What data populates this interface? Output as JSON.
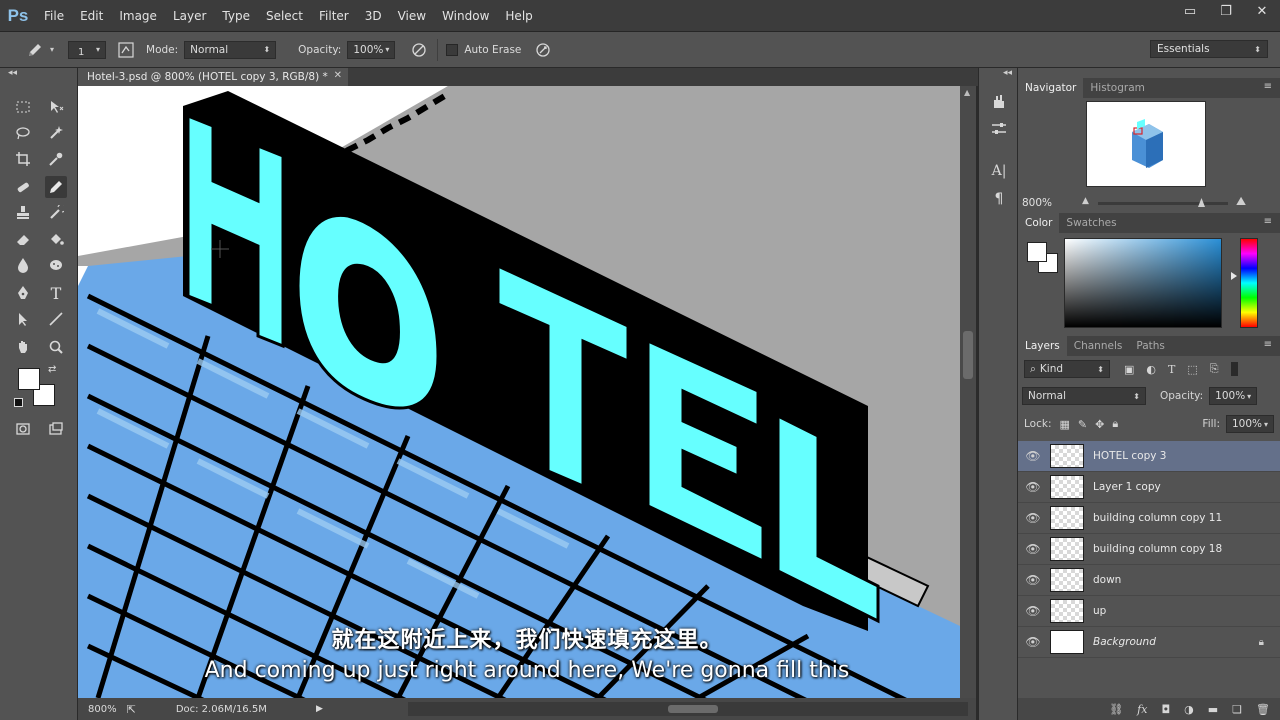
{
  "app": {
    "logo": "Ps"
  },
  "menu": [
    "File",
    "Edit",
    "Image",
    "Layer",
    "Type",
    "Select",
    "Filter",
    "3D",
    "View",
    "Window",
    "Help"
  ],
  "window_controls": {
    "minimize": "▭",
    "restore": "❐",
    "close": "✕"
  },
  "options_bar": {
    "brush_size": "1",
    "mode_label": "Mode:",
    "mode_value": "Normal",
    "opacity_label": "Opacity:",
    "opacity_value": "100%",
    "auto_erase_label": "Auto Erase",
    "workspace": "Essentials"
  },
  "document": {
    "tab_title": "Hotel-3.psd @ 800% (HOTEL copy 3, RGB/8) *",
    "status_zoom": "800%",
    "status_doc": "Doc: 2.06M/16.5M"
  },
  "subtitle": {
    "chinese": "就在这附近上来，我们快速填充这里。",
    "english": "And coming up just right around here, We're gonna fill this"
  },
  "navigator": {
    "tabs": [
      "Navigator",
      "Histogram"
    ],
    "zoom": "800%"
  },
  "color_panel": {
    "tabs": [
      "Color",
      "Swatches"
    ]
  },
  "layers_panel": {
    "tabs": [
      "Layers",
      "Channels",
      "Paths"
    ],
    "filter_kind": "Kind",
    "blend_mode": "Normal",
    "opacity_label": "Opacity:",
    "opacity_value": "100%",
    "lock_label": "Lock:",
    "fill_label": "Fill:",
    "fill_value": "100%",
    "layers": [
      {
        "name": "HOTEL copy 3",
        "selected": true
      },
      {
        "name": "Layer 1 copy",
        "selected": false
      },
      {
        "name": "building column copy 11",
        "selected": false
      },
      {
        "name": "building column copy 18",
        "selected": false
      },
      {
        "name": "down",
        "selected": false
      },
      {
        "name": "up",
        "selected": false
      },
      {
        "name": "Background",
        "selected": false
      }
    ]
  },
  "colors": {
    "sign_face": "#66ffff",
    "glass_light": "#9ccbf2",
    "glass_mid": "#6aa8e8",
    "outline": "#000000",
    "selected_layer": "#64708a"
  }
}
